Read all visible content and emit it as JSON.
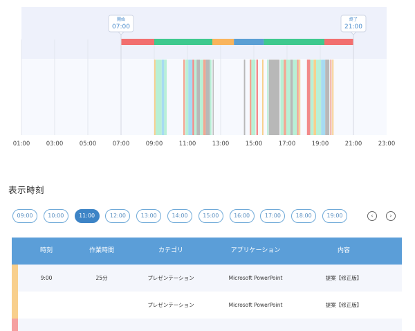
{
  "timeline": {
    "start_label": "開始",
    "start_time": "07:00",
    "end_label": "終了",
    "end_time": "21:00",
    "hour_range": [
      1,
      23
    ],
    "ticks": [
      "01:00",
      "03:00",
      "05:00",
      "07:00",
      "09:00",
      "11:00",
      "13:00",
      "15:00",
      "17:00",
      "19:00",
      "21:00",
      "23:00"
    ],
    "colors": {
      "red": "#f26f6f",
      "green": "#3ec98e",
      "orange": "#f9b45c",
      "blue": "#5a9fd4",
      "light_green": "#b8f0d6",
      "light_blue": "#a6dbf2",
      "gray": "#b8b8b8",
      "salmon": "#f3a691",
      "peach": "#f8cf8c",
      "rose": "#f28a8a"
    },
    "category_bar": [
      {
        "from": 7.0,
        "to": 9.0,
        "color": "red"
      },
      {
        "from": 9.0,
        "to": 12.5,
        "color": "green"
      },
      {
        "from": 12.5,
        "to": 13.8,
        "color": "orange"
      },
      {
        "from": 13.8,
        "to": 15.6,
        "color": "blue"
      },
      {
        "from": 15.6,
        "to": 19.25,
        "color": "green"
      },
      {
        "from": 19.25,
        "to": 21.0,
        "color": "red"
      }
    ],
    "activities": [
      {
        "from": 9.0,
        "to": 9.08,
        "color": "peach"
      },
      {
        "from": 9.08,
        "to": 9.45,
        "color": "light_green"
      },
      {
        "from": 9.45,
        "to": 9.6,
        "color": "light_blue"
      },
      {
        "from": 9.6,
        "to": 9.75,
        "color": "light_green"
      },
      {
        "from": 10.75,
        "to": 10.85,
        "color": "salmon"
      },
      {
        "from": 10.88,
        "to": 11.05,
        "color": "light_green"
      },
      {
        "from": 11.05,
        "to": 11.3,
        "color": "light_blue"
      },
      {
        "from": 11.3,
        "to": 11.4,
        "color": "rose"
      },
      {
        "from": 11.4,
        "to": 11.55,
        "color": "light_green"
      },
      {
        "from": 11.55,
        "to": 11.75,
        "color": "gray"
      },
      {
        "from": 11.75,
        "to": 11.95,
        "color": "light_green"
      },
      {
        "from": 11.95,
        "to": 12.1,
        "color": "salmon"
      },
      {
        "from": 12.1,
        "to": 12.35,
        "color": "gray"
      },
      {
        "from": 12.35,
        "to": 12.45,
        "color": "light_green"
      },
      {
        "from": 12.52,
        "to": 12.58,
        "color": "gray"
      },
      {
        "from": 14.4,
        "to": 14.48,
        "color": "gray"
      },
      {
        "from": 14.75,
        "to": 14.85,
        "color": "salmon"
      },
      {
        "from": 14.85,
        "to": 15.1,
        "color": "light_green"
      },
      {
        "from": 15.15,
        "to": 15.25,
        "color": "rose"
      },
      {
        "from": 15.5,
        "to": 15.58,
        "color": "peach"
      },
      {
        "from": 15.8,
        "to": 15.88,
        "color": "light_green"
      },
      {
        "from": 15.9,
        "to": 16.55,
        "color": "gray"
      },
      {
        "from": 16.6,
        "to": 16.8,
        "color": "light_green"
      },
      {
        "from": 16.8,
        "to": 16.95,
        "color": "salmon"
      },
      {
        "from": 16.95,
        "to": 17.2,
        "color": "light_green"
      },
      {
        "from": 17.2,
        "to": 17.35,
        "color": "gray"
      },
      {
        "from": 17.35,
        "to": 17.6,
        "color": "light_green"
      },
      {
        "from": 17.6,
        "to": 17.7,
        "color": "salmon"
      },
      {
        "from": 17.72,
        "to": 17.8,
        "color": "peach"
      },
      {
        "from": 18.2,
        "to": 18.4,
        "color": "rose"
      },
      {
        "from": 18.4,
        "to": 18.6,
        "color": "light_green"
      },
      {
        "from": 18.6,
        "to": 18.75,
        "color": "peach"
      },
      {
        "from": 18.75,
        "to": 19.05,
        "color": "light_green"
      },
      {
        "from": 19.05,
        "to": 19.3,
        "color": "light_blue"
      },
      {
        "from": 19.3,
        "to": 19.55,
        "color": "gray"
      },
      {
        "from": 19.6,
        "to": 19.68,
        "color": "salmon"
      },
      {
        "from": 19.72,
        "to": 19.8,
        "color": "peach"
      }
    ]
  },
  "section_title": "表示時刻",
  "hour_pills": [
    "09:00",
    "10:00",
    "11:00",
    "12:00",
    "13:00",
    "14:00",
    "15:00",
    "16:00",
    "17:00",
    "18:00",
    "19:00"
  ],
  "active_hour": "11:00",
  "nav": {
    "prev": "‹",
    "next": "›"
  },
  "table": {
    "headers": [
      "時刻",
      "作業時間",
      "カテゴリ",
      "アプリケーション",
      "内容"
    ],
    "rows": [
      {
        "mark": "#f8cf8c",
        "time": "9:00",
        "duration": "25分",
        "category": "プレゼンテーション",
        "app": "Microsoft PowerPoint",
        "content": "提案【修正版】"
      },
      {
        "mark": "#f8cf8c",
        "time": "",
        "duration": "",
        "category": "プレゼンテーション",
        "app": "Microsoft PowerPoint",
        "content": "提案【修正版】"
      },
      {
        "mark": "#f5a0a0",
        "time": "",
        "duration": "",
        "category": "",
        "app": "",
        "content": ""
      }
    ]
  }
}
